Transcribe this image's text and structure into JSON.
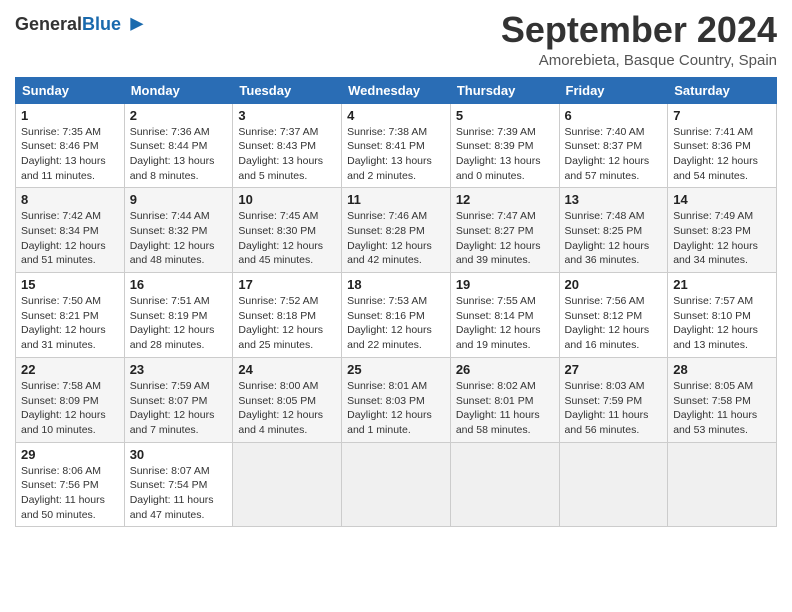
{
  "logo": {
    "general": "General",
    "blue": "Blue"
  },
  "title": "September 2024",
  "location": "Amorebieta, Basque Country, Spain",
  "days_of_week": [
    "Sunday",
    "Monday",
    "Tuesday",
    "Wednesday",
    "Thursday",
    "Friday",
    "Saturday"
  ],
  "weeks": [
    [
      {
        "day": "1",
        "sunrise": "7:35 AM",
        "sunset": "8:46 PM",
        "daylight": "13 hours and 11 minutes."
      },
      {
        "day": "2",
        "sunrise": "7:36 AM",
        "sunset": "8:44 PM",
        "daylight": "13 hours and 8 minutes."
      },
      {
        "day": "3",
        "sunrise": "7:37 AM",
        "sunset": "8:43 PM",
        "daylight": "13 hours and 5 minutes."
      },
      {
        "day": "4",
        "sunrise": "7:38 AM",
        "sunset": "8:41 PM",
        "daylight": "13 hours and 2 minutes."
      },
      {
        "day": "5",
        "sunrise": "7:39 AM",
        "sunset": "8:39 PM",
        "daylight": "13 hours and 0 minutes."
      },
      {
        "day": "6",
        "sunrise": "7:40 AM",
        "sunset": "8:37 PM",
        "daylight": "12 hours and 57 minutes."
      },
      {
        "day": "7",
        "sunrise": "7:41 AM",
        "sunset": "8:36 PM",
        "daylight": "12 hours and 54 minutes."
      }
    ],
    [
      {
        "day": "8",
        "sunrise": "7:42 AM",
        "sunset": "8:34 PM",
        "daylight": "12 hours and 51 minutes."
      },
      {
        "day": "9",
        "sunrise": "7:44 AM",
        "sunset": "8:32 PM",
        "daylight": "12 hours and 48 minutes."
      },
      {
        "day": "10",
        "sunrise": "7:45 AM",
        "sunset": "8:30 PM",
        "daylight": "12 hours and 45 minutes."
      },
      {
        "day": "11",
        "sunrise": "7:46 AM",
        "sunset": "8:28 PM",
        "daylight": "12 hours and 42 minutes."
      },
      {
        "day": "12",
        "sunrise": "7:47 AM",
        "sunset": "8:27 PM",
        "daylight": "12 hours and 39 minutes."
      },
      {
        "day": "13",
        "sunrise": "7:48 AM",
        "sunset": "8:25 PM",
        "daylight": "12 hours and 36 minutes."
      },
      {
        "day": "14",
        "sunrise": "7:49 AM",
        "sunset": "8:23 PM",
        "daylight": "12 hours and 34 minutes."
      }
    ],
    [
      {
        "day": "15",
        "sunrise": "7:50 AM",
        "sunset": "8:21 PM",
        "daylight": "12 hours and 31 minutes."
      },
      {
        "day": "16",
        "sunrise": "7:51 AM",
        "sunset": "8:19 PM",
        "daylight": "12 hours and 28 minutes."
      },
      {
        "day": "17",
        "sunrise": "7:52 AM",
        "sunset": "8:18 PM",
        "daylight": "12 hours and 25 minutes."
      },
      {
        "day": "18",
        "sunrise": "7:53 AM",
        "sunset": "8:16 PM",
        "daylight": "12 hours and 22 minutes."
      },
      {
        "day": "19",
        "sunrise": "7:55 AM",
        "sunset": "8:14 PM",
        "daylight": "12 hours and 19 minutes."
      },
      {
        "day": "20",
        "sunrise": "7:56 AM",
        "sunset": "8:12 PM",
        "daylight": "12 hours and 16 minutes."
      },
      {
        "day": "21",
        "sunrise": "7:57 AM",
        "sunset": "8:10 PM",
        "daylight": "12 hours and 13 minutes."
      }
    ],
    [
      {
        "day": "22",
        "sunrise": "7:58 AM",
        "sunset": "8:09 PM",
        "daylight": "12 hours and 10 minutes."
      },
      {
        "day": "23",
        "sunrise": "7:59 AM",
        "sunset": "8:07 PM",
        "daylight": "12 hours and 7 minutes."
      },
      {
        "day": "24",
        "sunrise": "8:00 AM",
        "sunset": "8:05 PM",
        "daylight": "12 hours and 4 minutes."
      },
      {
        "day": "25",
        "sunrise": "8:01 AM",
        "sunset": "8:03 PM",
        "daylight": "12 hours and 1 minute."
      },
      {
        "day": "26",
        "sunrise": "8:02 AM",
        "sunset": "8:01 PM",
        "daylight": "11 hours and 58 minutes."
      },
      {
        "day": "27",
        "sunrise": "8:03 AM",
        "sunset": "7:59 PM",
        "daylight": "11 hours and 56 minutes."
      },
      {
        "day": "28",
        "sunrise": "8:05 AM",
        "sunset": "7:58 PM",
        "daylight": "11 hours and 53 minutes."
      }
    ],
    [
      {
        "day": "29",
        "sunrise": "8:06 AM",
        "sunset": "7:56 PM",
        "daylight": "11 hours and 50 minutes."
      },
      {
        "day": "30",
        "sunrise": "8:07 AM",
        "sunset": "7:54 PM",
        "daylight": "11 hours and 47 minutes."
      },
      null,
      null,
      null,
      null,
      null
    ]
  ]
}
